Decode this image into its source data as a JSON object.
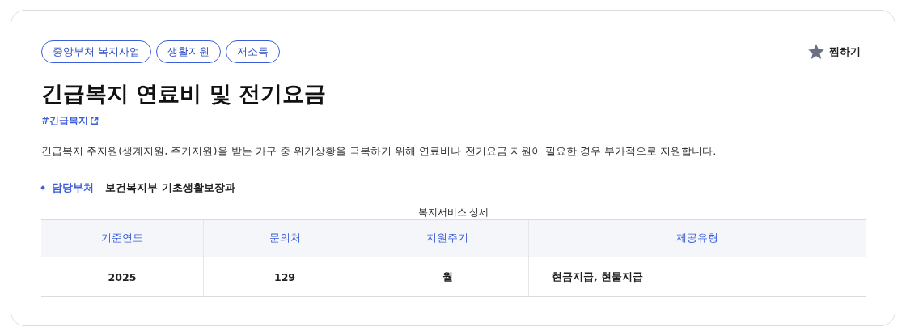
{
  "tags": [
    "중앙부처 복지사업",
    "생활지원",
    "저소득"
  ],
  "favorite": {
    "label": "찜하기",
    "selected": false
  },
  "title": "긴급복지 연료비 및 전기요금",
  "hashtag": "#긴급복지",
  "description": "긴급복지 주지원(생계지원, 주거지원)을 받는 가구 중 위기상황을 극복하기 위해 연료비나 전기요금 지원이 필요한 경우 부가적으로 지원합니다.",
  "department": {
    "label": "담당부처",
    "value": "보건복지부 기초생활보장과"
  },
  "table": {
    "caption": "복지서비스 상세",
    "columns": [
      "기준연도",
      "문의처",
      "지원주기",
      "제공유형"
    ],
    "rows": [
      [
        "2025",
        "129",
        "월",
        "현금지급, 현물지급"
      ]
    ]
  }
}
